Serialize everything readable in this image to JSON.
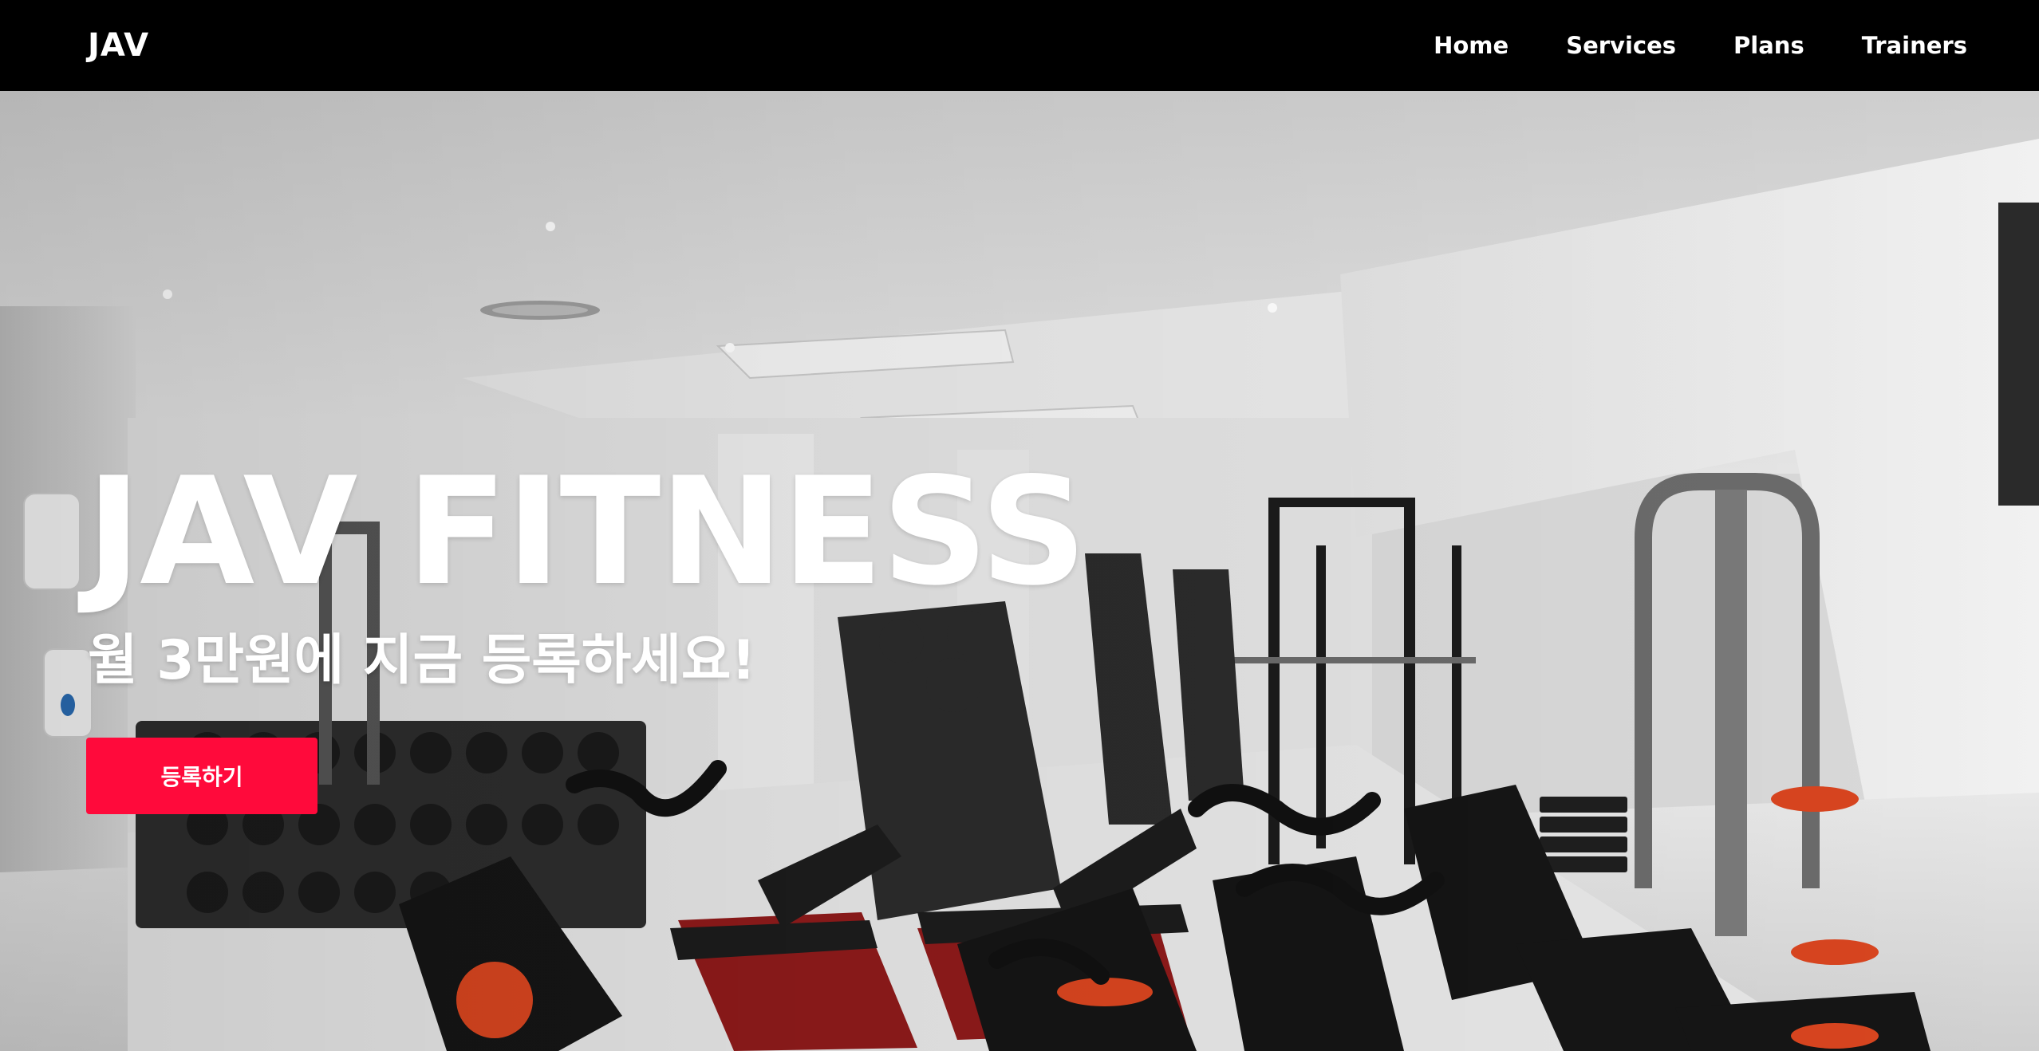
{
  "brand": {
    "logo_text": "JAV"
  },
  "nav": {
    "items": [
      {
        "label": "Home"
      },
      {
        "label": "Services"
      },
      {
        "label": "Plans"
      },
      {
        "label": "Trainers"
      }
    ]
  },
  "hero": {
    "title": "JAV FITNESS",
    "subtitle": "월 3만원에 지금 등록하세요!",
    "cta_label": "등록하기",
    "background": "gym interior photo with dumbbell racks, benches and exercise bikes"
  },
  "colors": {
    "navbar_bg": "#000000",
    "accent": "#ff0a3b",
    "text": "#ffffff"
  }
}
